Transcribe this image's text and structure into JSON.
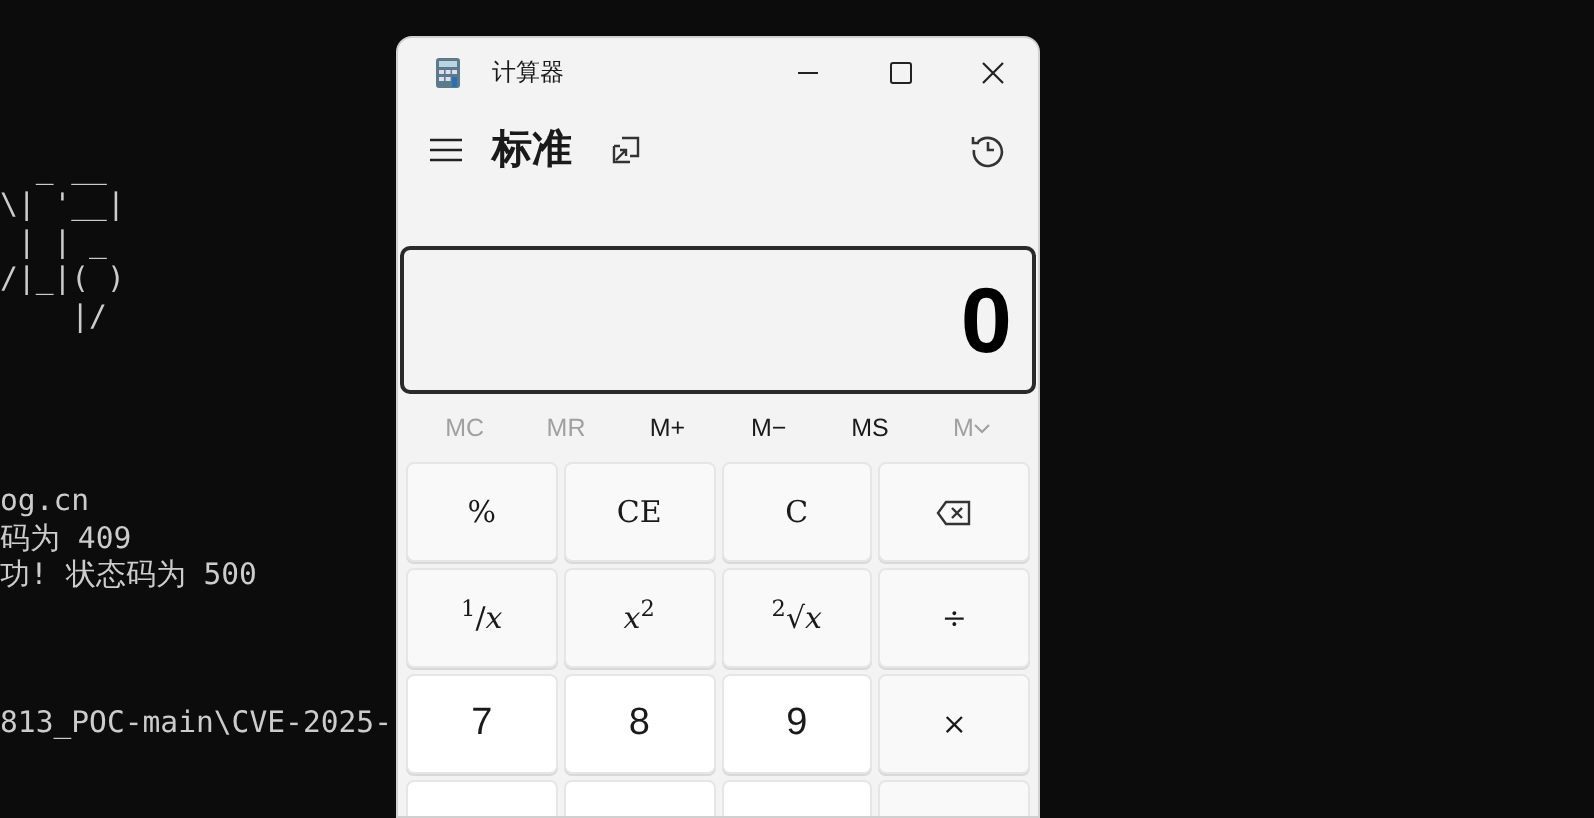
{
  "terminal": {
    "blocks": [
      {
        "lines": [
          "  _ __",
          "\\| '__|",
          " | | _",
          "/|_|( )",
          "    |/"
        ]
      },
      {
        "lines": [
          "og.cn",
          "码为 409",
          "功! 状态码为 500"
        ]
      },
      {
        "lines": [
          "813_POC-main\\CVE-2025-"
        ]
      }
    ]
  },
  "window": {
    "title": "计算器"
  },
  "header": {
    "mode": "标准"
  },
  "display": {
    "value": "0"
  },
  "memory": [
    {
      "label": "MC",
      "disabled": true,
      "kind": "plain"
    },
    {
      "label": "MR",
      "disabled": true,
      "kind": "plain"
    },
    {
      "label": "M+",
      "disabled": false,
      "kind": "plain"
    },
    {
      "label": "M−",
      "disabled": false,
      "kind": "plain"
    },
    {
      "label": "MS",
      "disabled": false,
      "kind": "plain"
    },
    {
      "label": "M",
      "disabled": true,
      "kind": "dropdown"
    }
  ],
  "keys": [
    {
      "label": "%",
      "kind": "function"
    },
    {
      "label": "CE",
      "kind": "function"
    },
    {
      "label": "C",
      "kind": "function"
    },
    {
      "kind": "backspace"
    },
    {
      "label": "$^{1}$/*x*",
      "kind": "function"
    },
    {
      "label": "*x*$^{2}$",
      "kind": "function"
    },
    {
      "label": "$^{2}$√*x*",
      "kind": "function"
    },
    {
      "label": "÷",
      "kind": "function"
    },
    {
      "label": "7",
      "kind": "digit"
    },
    {
      "label": "8",
      "kind": "digit"
    },
    {
      "label": "9",
      "kind": "digit"
    },
    {
      "label": "×",
      "kind": "function"
    }
  ]
}
